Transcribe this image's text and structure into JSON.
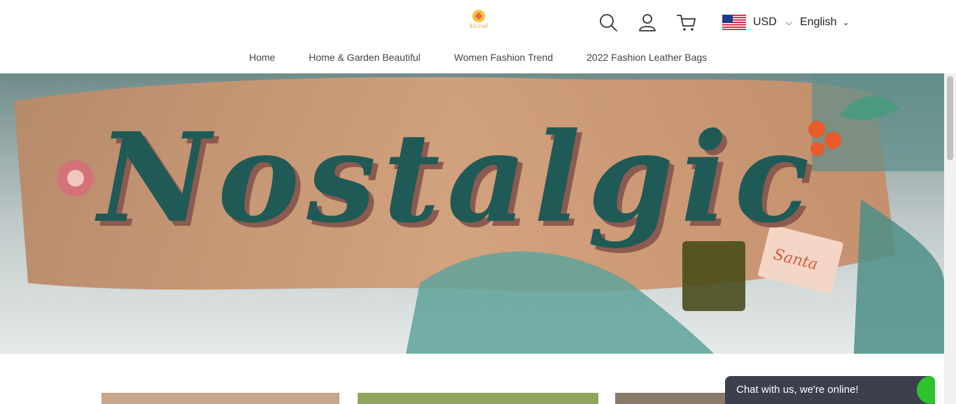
{
  "header": {
    "logo_text": "kiccod",
    "icons": [
      "search-icon",
      "user-icon",
      "cart-icon"
    ],
    "currency": "USD",
    "language": "English"
  },
  "nav": {
    "items": [
      {
        "label": "Home"
      },
      {
        "label": "Home & Garden Beautiful"
      },
      {
        "label": "Women Fashion Trend"
      },
      {
        "label": "2022 Fashion Leather Bags"
      }
    ]
  },
  "hero": {
    "title": "Nostalgic",
    "tag": "Santa"
  },
  "chat": {
    "label": "Chat with us, we're online!"
  },
  "colors": {
    "hero_text": "#1f5a57",
    "hero_band": "#c9946a",
    "chat_bg": "#3d3f4f",
    "chat_dot": "#2fc12f"
  }
}
